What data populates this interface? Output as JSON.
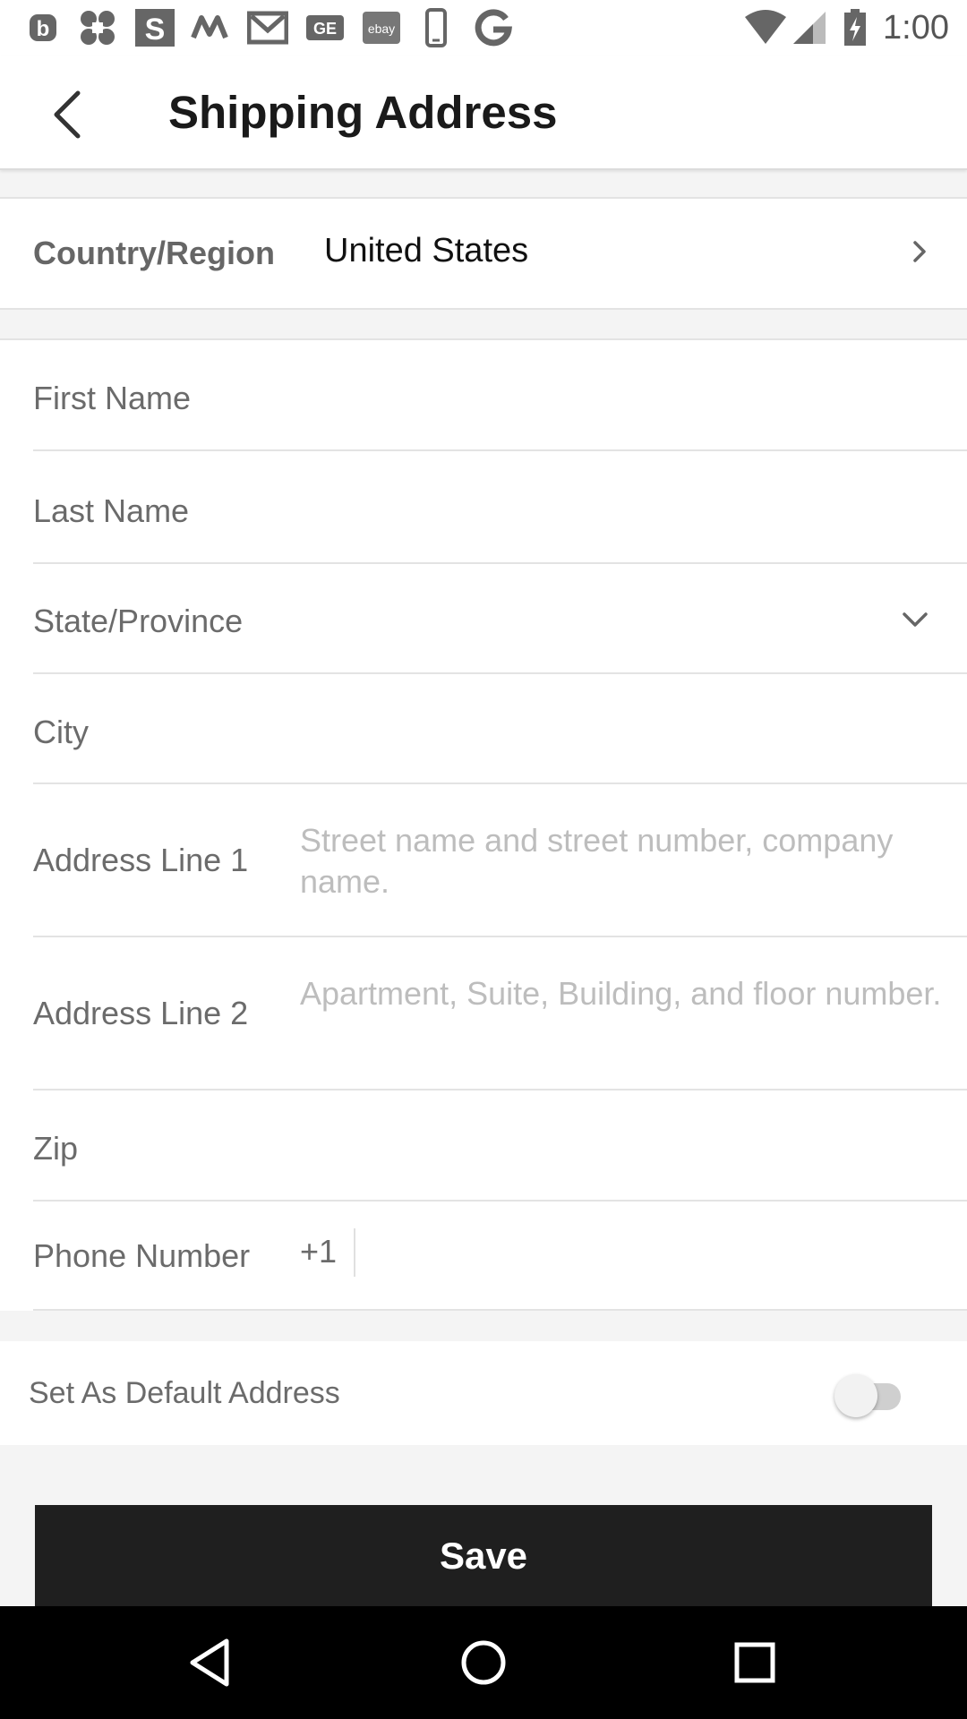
{
  "status_bar": {
    "time": "1:00",
    "notification_icons": [
      "b-app-icon",
      "fandango-icon",
      "s-app-icon",
      "m-app-icon",
      "gmail-icon",
      "ge-icon",
      "ebay-icon",
      "phone-icon",
      "google-icon"
    ],
    "ebay_text": "ebay"
  },
  "header": {
    "title": "Shipping Address"
  },
  "country": {
    "label": "Country/Region",
    "value": "United States"
  },
  "form": {
    "first_name": {
      "label": "First Name",
      "value": ""
    },
    "last_name": {
      "label": "Last Name",
      "value": ""
    },
    "state": {
      "label": "State/Province",
      "value": ""
    },
    "city": {
      "label": "City",
      "value": ""
    },
    "address1": {
      "label": "Address Line 1",
      "placeholder": "Street name and street number, company name.",
      "value": ""
    },
    "address2": {
      "label": "Address Line 2",
      "placeholder": "Apartment, Suite, Building, and floor number.",
      "value": ""
    },
    "zip": {
      "label": "Zip",
      "value": ""
    },
    "phone": {
      "label": "Phone Number",
      "code": "+1",
      "value": ""
    }
  },
  "default_address": {
    "label": "Set As Default Address",
    "enabled": false
  },
  "save": {
    "label": "Save"
  },
  "colors": {
    "primary_button": "#1f1f1f",
    "background": "#f4f4f4",
    "placeholder": "#bdbdbd"
  }
}
